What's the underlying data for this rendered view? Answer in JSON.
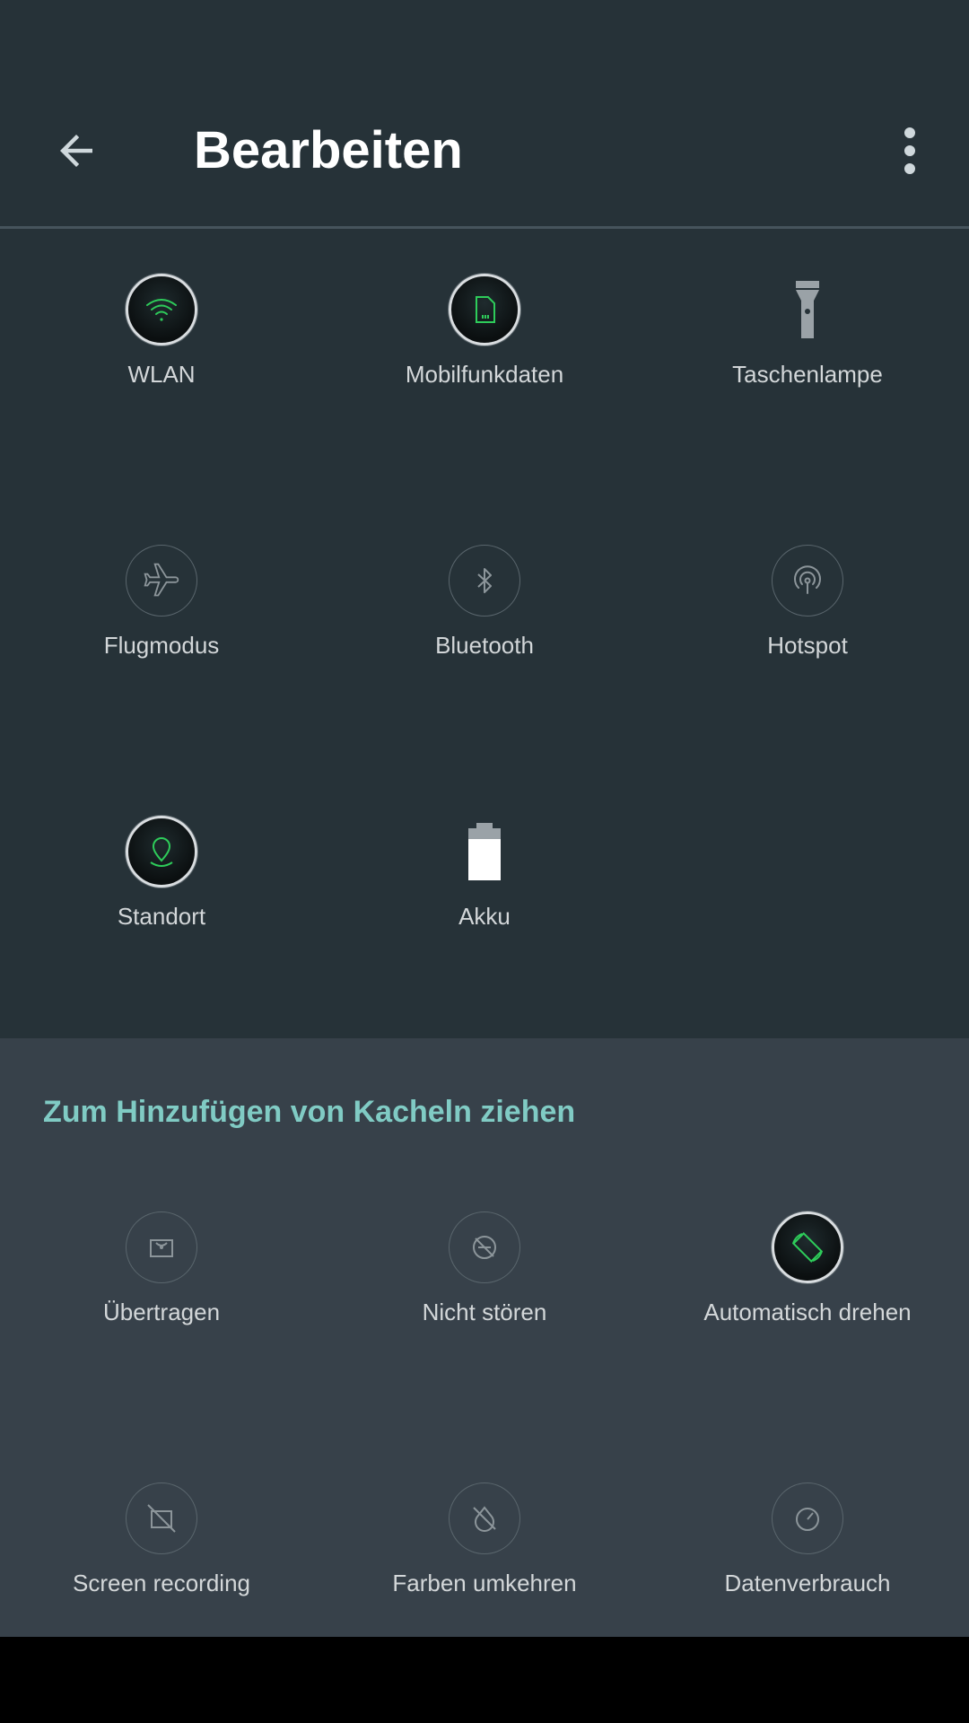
{
  "header": {
    "title": "Bearbeiten",
    "back_icon": "arrow-back-icon",
    "menu_icon": "more-vert-icon"
  },
  "colors": {
    "background": "#263238",
    "add_section_background": "#37414a",
    "accent": "#80cbc4",
    "active_icon": "#2ecc5a"
  },
  "active_tiles": [
    {
      "label": "WLAN",
      "icon": "wifi-icon",
      "state": "on"
    },
    {
      "label": "Mobilfunkdaten",
      "icon": "sim-card-icon",
      "state": "on"
    },
    {
      "label": "Taschenlampe",
      "icon": "flashlight-icon",
      "state": "off"
    },
    {
      "label": "Flugmodus",
      "icon": "airplane-icon",
      "state": "off"
    },
    {
      "label": "Bluetooth",
      "icon": "bluetooth-icon",
      "state": "off"
    },
    {
      "label": "Hotspot",
      "icon": "hotspot-icon",
      "state": "off"
    },
    {
      "label": "Standort",
      "icon": "location-icon",
      "state": "on"
    },
    {
      "label": "Akku",
      "icon": "battery-icon",
      "state": "on"
    }
  ],
  "add_section": {
    "title": "Zum Hinzufügen von Kacheln ziehen",
    "tiles": [
      {
        "label": "Übertragen",
        "icon": "cast-icon",
        "state": "off"
      },
      {
        "label": "Nicht stören",
        "icon": "do-not-disturb-icon",
        "state": "off"
      },
      {
        "label": "Automatisch drehen",
        "icon": "auto-rotate-icon",
        "state": "on"
      },
      {
        "label": "Screen recording",
        "icon": "screen-recording-off-icon",
        "state": "off"
      },
      {
        "label": "Farben umkehren",
        "icon": "invert-colors-off-icon",
        "state": "off"
      },
      {
        "label": "Datenverbrauch",
        "icon": "data-usage-icon",
        "state": "off"
      }
    ]
  }
}
